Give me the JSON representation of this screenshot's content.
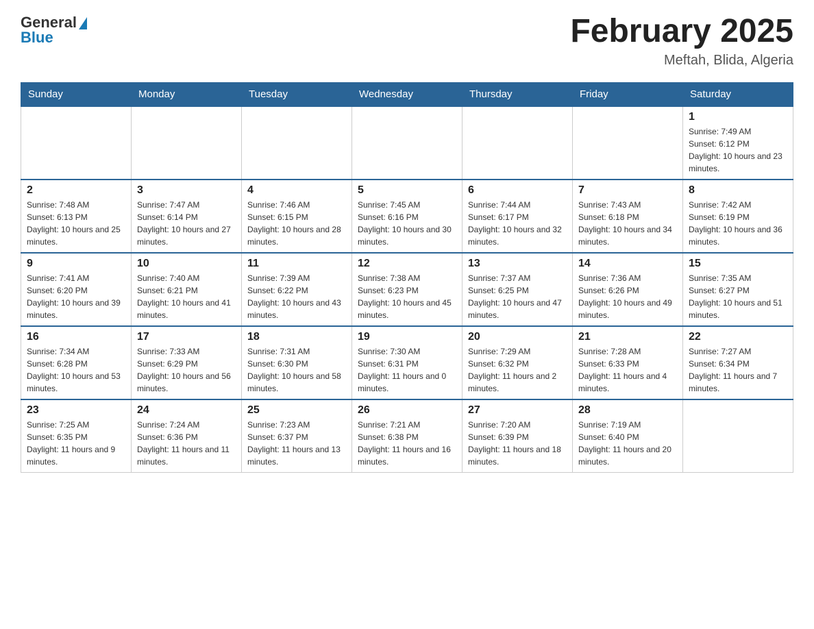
{
  "logo": {
    "general": "General",
    "blue": "Blue"
  },
  "header": {
    "title": "February 2025",
    "location": "Meftah, Blida, Algeria"
  },
  "days_of_week": [
    "Sunday",
    "Monday",
    "Tuesday",
    "Wednesday",
    "Thursday",
    "Friday",
    "Saturday"
  ],
  "weeks": [
    {
      "days": [
        {
          "number": "",
          "info": "",
          "empty": true
        },
        {
          "number": "",
          "info": "",
          "empty": true
        },
        {
          "number": "",
          "info": "",
          "empty": true
        },
        {
          "number": "",
          "info": "",
          "empty": true
        },
        {
          "number": "",
          "info": "",
          "empty": true
        },
        {
          "number": "",
          "info": "",
          "empty": true
        },
        {
          "number": "1",
          "info": "Sunrise: 7:49 AM\nSunset: 6:12 PM\nDaylight: 10 hours and 23 minutes.",
          "empty": false
        }
      ]
    },
    {
      "days": [
        {
          "number": "2",
          "info": "Sunrise: 7:48 AM\nSunset: 6:13 PM\nDaylight: 10 hours and 25 minutes.",
          "empty": false
        },
        {
          "number": "3",
          "info": "Sunrise: 7:47 AM\nSunset: 6:14 PM\nDaylight: 10 hours and 27 minutes.",
          "empty": false
        },
        {
          "number": "4",
          "info": "Sunrise: 7:46 AM\nSunset: 6:15 PM\nDaylight: 10 hours and 28 minutes.",
          "empty": false
        },
        {
          "number": "5",
          "info": "Sunrise: 7:45 AM\nSunset: 6:16 PM\nDaylight: 10 hours and 30 minutes.",
          "empty": false
        },
        {
          "number": "6",
          "info": "Sunrise: 7:44 AM\nSunset: 6:17 PM\nDaylight: 10 hours and 32 minutes.",
          "empty": false
        },
        {
          "number": "7",
          "info": "Sunrise: 7:43 AM\nSunset: 6:18 PM\nDaylight: 10 hours and 34 minutes.",
          "empty": false
        },
        {
          "number": "8",
          "info": "Sunrise: 7:42 AM\nSunset: 6:19 PM\nDaylight: 10 hours and 36 minutes.",
          "empty": false
        }
      ]
    },
    {
      "days": [
        {
          "number": "9",
          "info": "Sunrise: 7:41 AM\nSunset: 6:20 PM\nDaylight: 10 hours and 39 minutes.",
          "empty": false
        },
        {
          "number": "10",
          "info": "Sunrise: 7:40 AM\nSunset: 6:21 PM\nDaylight: 10 hours and 41 minutes.",
          "empty": false
        },
        {
          "number": "11",
          "info": "Sunrise: 7:39 AM\nSunset: 6:22 PM\nDaylight: 10 hours and 43 minutes.",
          "empty": false
        },
        {
          "number": "12",
          "info": "Sunrise: 7:38 AM\nSunset: 6:23 PM\nDaylight: 10 hours and 45 minutes.",
          "empty": false
        },
        {
          "number": "13",
          "info": "Sunrise: 7:37 AM\nSunset: 6:25 PM\nDaylight: 10 hours and 47 minutes.",
          "empty": false
        },
        {
          "number": "14",
          "info": "Sunrise: 7:36 AM\nSunset: 6:26 PM\nDaylight: 10 hours and 49 minutes.",
          "empty": false
        },
        {
          "number": "15",
          "info": "Sunrise: 7:35 AM\nSunset: 6:27 PM\nDaylight: 10 hours and 51 minutes.",
          "empty": false
        }
      ]
    },
    {
      "days": [
        {
          "number": "16",
          "info": "Sunrise: 7:34 AM\nSunset: 6:28 PM\nDaylight: 10 hours and 53 minutes.",
          "empty": false
        },
        {
          "number": "17",
          "info": "Sunrise: 7:33 AM\nSunset: 6:29 PM\nDaylight: 10 hours and 56 minutes.",
          "empty": false
        },
        {
          "number": "18",
          "info": "Sunrise: 7:31 AM\nSunset: 6:30 PM\nDaylight: 10 hours and 58 minutes.",
          "empty": false
        },
        {
          "number": "19",
          "info": "Sunrise: 7:30 AM\nSunset: 6:31 PM\nDaylight: 11 hours and 0 minutes.",
          "empty": false
        },
        {
          "number": "20",
          "info": "Sunrise: 7:29 AM\nSunset: 6:32 PM\nDaylight: 11 hours and 2 minutes.",
          "empty": false
        },
        {
          "number": "21",
          "info": "Sunrise: 7:28 AM\nSunset: 6:33 PM\nDaylight: 11 hours and 4 minutes.",
          "empty": false
        },
        {
          "number": "22",
          "info": "Sunrise: 7:27 AM\nSunset: 6:34 PM\nDaylight: 11 hours and 7 minutes.",
          "empty": false
        }
      ]
    },
    {
      "days": [
        {
          "number": "23",
          "info": "Sunrise: 7:25 AM\nSunset: 6:35 PM\nDaylight: 11 hours and 9 minutes.",
          "empty": false
        },
        {
          "number": "24",
          "info": "Sunrise: 7:24 AM\nSunset: 6:36 PM\nDaylight: 11 hours and 11 minutes.",
          "empty": false
        },
        {
          "number": "25",
          "info": "Sunrise: 7:23 AM\nSunset: 6:37 PM\nDaylight: 11 hours and 13 minutes.",
          "empty": false
        },
        {
          "number": "26",
          "info": "Sunrise: 7:21 AM\nSunset: 6:38 PM\nDaylight: 11 hours and 16 minutes.",
          "empty": false
        },
        {
          "number": "27",
          "info": "Sunrise: 7:20 AM\nSunset: 6:39 PM\nDaylight: 11 hours and 18 minutes.",
          "empty": false
        },
        {
          "number": "28",
          "info": "Sunrise: 7:19 AM\nSunset: 6:40 PM\nDaylight: 11 hours and 20 minutes.",
          "empty": false
        },
        {
          "number": "",
          "info": "",
          "empty": true
        }
      ]
    }
  ]
}
